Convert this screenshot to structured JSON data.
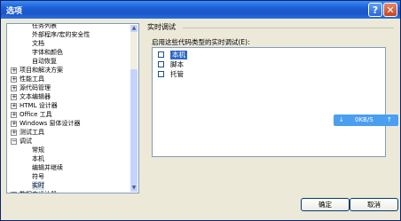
{
  "window": {
    "title": "选项",
    "help_glyph": "?",
    "close_glyph": "✕"
  },
  "tree": {
    "items": [
      {
        "label": "任务列表",
        "indent": 1,
        "expander": ""
      },
      {
        "label": "外部程序/宏的安全性",
        "indent": 1,
        "expander": ""
      },
      {
        "label": "文档",
        "indent": 1,
        "expander": ""
      },
      {
        "label": "字体和颜色",
        "indent": 1,
        "expander": ""
      },
      {
        "label": "自动恢复",
        "indent": 1,
        "expander": ""
      },
      {
        "label": "项目和解决方案",
        "indent": 0,
        "expander": "+"
      },
      {
        "label": "性能工具",
        "indent": 0,
        "expander": "+"
      },
      {
        "label": "源代码管理",
        "indent": 0,
        "expander": "+"
      },
      {
        "label": "文本编辑器",
        "indent": 0,
        "expander": "+"
      },
      {
        "label": "HTML 设计器",
        "indent": 0,
        "expander": "+"
      },
      {
        "label": "Office 工具",
        "indent": 0,
        "expander": "+"
      },
      {
        "label": "Windows 窗体设计器",
        "indent": 0,
        "expander": "+"
      },
      {
        "label": "测试工具",
        "indent": 0,
        "expander": "+"
      },
      {
        "label": "调试",
        "indent": 0,
        "expander": "−"
      },
      {
        "label": "常规",
        "indent": 1,
        "expander": ""
      },
      {
        "label": "本机",
        "indent": 1,
        "expander": ""
      },
      {
        "label": "编辑并继续",
        "indent": 1,
        "expander": ""
      },
      {
        "label": "符号",
        "indent": 1,
        "expander": ""
      },
      {
        "label": "实时",
        "indent": 1,
        "expander": "",
        "selected": true
      },
      {
        "label": "数据库设计器",
        "indent": 0,
        "expander": "+"
      }
    ],
    "scroll_up": "▲",
    "scroll_down": "▼"
  },
  "panel": {
    "title": "实时调试",
    "list_label": "启用这些代码类型的实时调试(E):",
    "options": [
      {
        "label": "本机",
        "selected": true
      },
      {
        "label": "脚本",
        "selected": false
      },
      {
        "label": "托管",
        "selected": false
      }
    ]
  },
  "netmeter": {
    "down": "↓",
    "value": "0KB/S",
    "up": "↑"
  },
  "buttons": {
    "ok": "确定",
    "cancel": "取消"
  }
}
